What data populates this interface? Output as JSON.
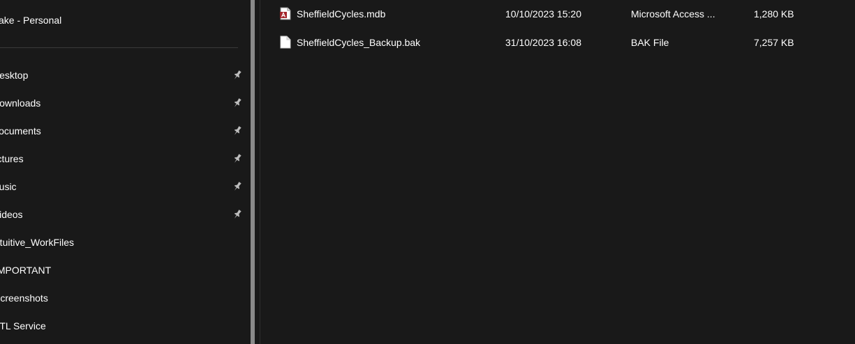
{
  "sidebar": {
    "account_label": "Jake - Personal",
    "items": [
      {
        "label": "Desktop",
        "pinned": true
      },
      {
        "label": "Downloads",
        "pinned": true
      },
      {
        "label": "Documents",
        "pinned": true
      },
      {
        "label": "Pictures",
        "pinned": true
      },
      {
        "label": "Music",
        "pinned": true
      },
      {
        "label": "Videos",
        "pinned": true
      },
      {
        "label": "Intuitive_WorkFiles",
        "pinned": false
      },
      {
        "label": "IMPORTANT",
        "pinned": false
      },
      {
        "label": "Screenshots",
        "pinned": false
      },
      {
        "label": "ETL Service",
        "pinned": false
      }
    ]
  },
  "files": [
    {
      "name": "SheffieldCycles.mdb",
      "date_modified": "10/10/2023 15:20",
      "type": "Microsoft Access ...",
      "size": "1,280 KB",
      "icon": "access-database-icon"
    },
    {
      "name": "SheffieldCycles_Backup.bak",
      "date_modified": "31/10/2023 16:08",
      "type": "BAK File",
      "size": "7,257 KB",
      "icon": "blank-file-icon"
    }
  ],
  "colors": {
    "background": "#191919",
    "text": "#ffffff",
    "access_red": "#a4262c",
    "pin": "#bdbdbd"
  }
}
